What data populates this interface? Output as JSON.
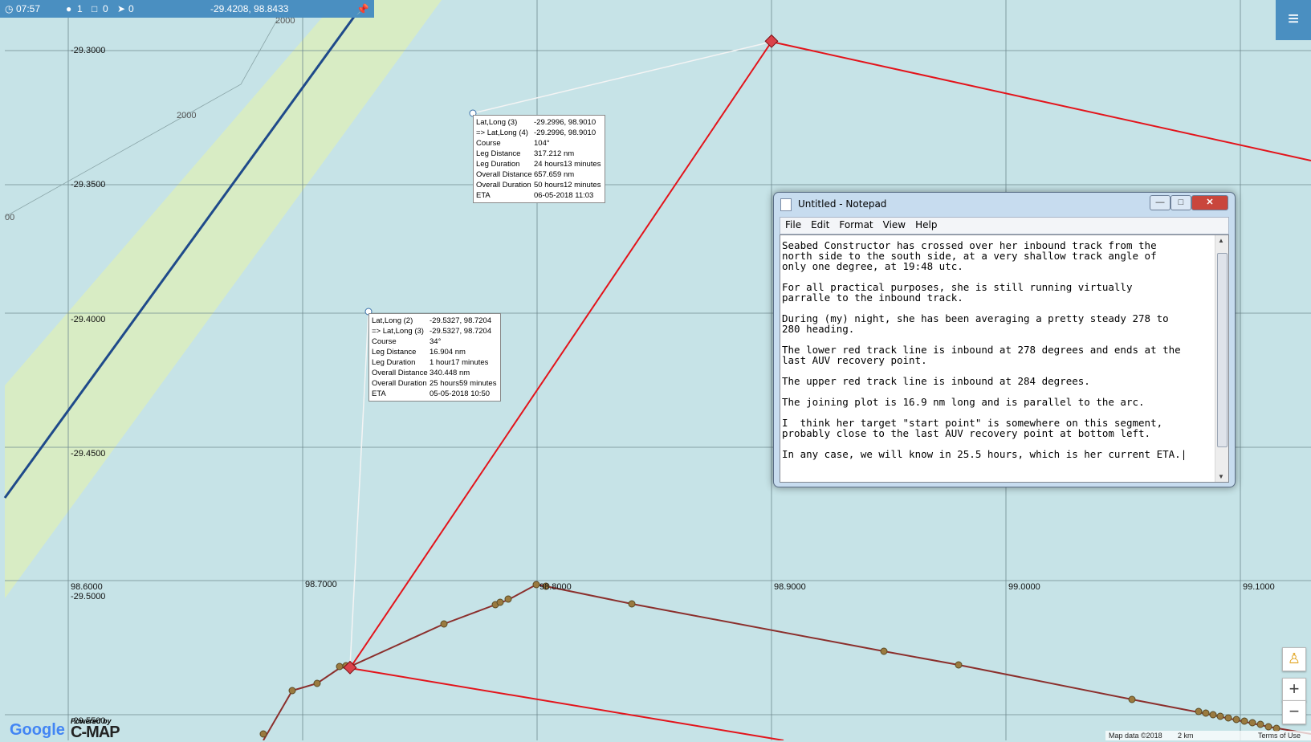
{
  "status_bar": {
    "time": "07:57",
    "count_a": "1",
    "count_b": "0",
    "count_c": "0",
    "coords": "-29.4208, 98.8433"
  },
  "lat_labels": [
    "-29.3000",
    "-29.3500",
    "-29.4000",
    "-29.4500",
    "-29.5000",
    "-29.5500"
  ],
  "lon_labels": [
    "98.6000",
    "98.7000",
    "98.8000",
    "98.9000",
    "99.0000",
    "99.1000"
  ],
  "contour_labels": [
    "2000",
    "2000",
    "00"
  ],
  "tooltip_upper": {
    "rows": [
      {
        "k": "Lat,Long (3)",
        "v": "-29.2996, 98.9010"
      },
      {
        "k": "=> Lat,Long (4)",
        "v": "-29.2996, 98.9010"
      },
      {
        "k": "Course",
        "v": "104°"
      },
      {
        "k": "Leg Distance",
        "v": "317.212 nm"
      },
      {
        "k": "Leg Duration",
        "v": "24 hours13 minutes"
      },
      {
        "k": "Overall Distance",
        "v": "657.659 nm"
      },
      {
        "k": "Overall Duration",
        "v": "50 hours12 minutes"
      },
      {
        "k": "ETA",
        "v": "06-05-2018 11:03"
      }
    ]
  },
  "tooltip_lower": {
    "rows": [
      {
        "k": "Lat,Long (2)",
        "v": "-29.5327, 98.7204"
      },
      {
        "k": "=> Lat,Long (3)",
        "v": "-29.5327, 98.7204"
      },
      {
        "k": "Course",
        "v": "34°"
      },
      {
        "k": "Leg Distance",
        "v": "16.904 nm"
      },
      {
        "k": "Leg Duration",
        "v": "1 hour17 minutes"
      },
      {
        "k": "Overall Distance",
        "v": "340.448 nm"
      },
      {
        "k": "Overall Duration",
        "v": "25 hours59 minutes"
      },
      {
        "k": "ETA",
        "v": "05-05-2018 10:50"
      }
    ]
  },
  "notepad": {
    "title": "Untitled - Notepad",
    "menu": [
      "File",
      "Edit",
      "Format",
      "View",
      "Help"
    ],
    "content": "Seabed Constructor has crossed over her inbound track from the\nnorth side to the south side, at a very shallow track angle of\nonly one degree, at 19:48 utc.\n\nFor all practical purposes, she is still running virtually\nparralle to the inbound track.\n\nDuring (my) night, she has been averaging a pretty steady 278 to\n280 heading.\n\nThe lower red track line is inbound at 278 degrees and ends at the\nlast AUV recovery point.\n\nThe upper red track line is inbound at 284 degrees.\n\nThe joining plot is 16.9 nm long and is parallel to the arc.\n\nI  think her target \"start point\" is somewhere on this segment,\nprobably close to the last AUV recovery point at bottom left.\n\nIn any case, we will know in 25.5 hours, which is her current ETA.|"
  },
  "footer": {
    "map_data": "Map data ©2018",
    "scale": "2 km",
    "terms": "Terms of Use"
  },
  "branding": {
    "google": "Google",
    "powered_by": "Powered by",
    "cmap": "C-MAP"
  },
  "colors": {
    "water": "#c6e3e7",
    "band": "#d8ecc4",
    "track_blue": "#1f4a8a",
    "route_red": "#e3141b",
    "track_brown": "#8b2f2c",
    "status_blue": "#4a8fc1"
  }
}
